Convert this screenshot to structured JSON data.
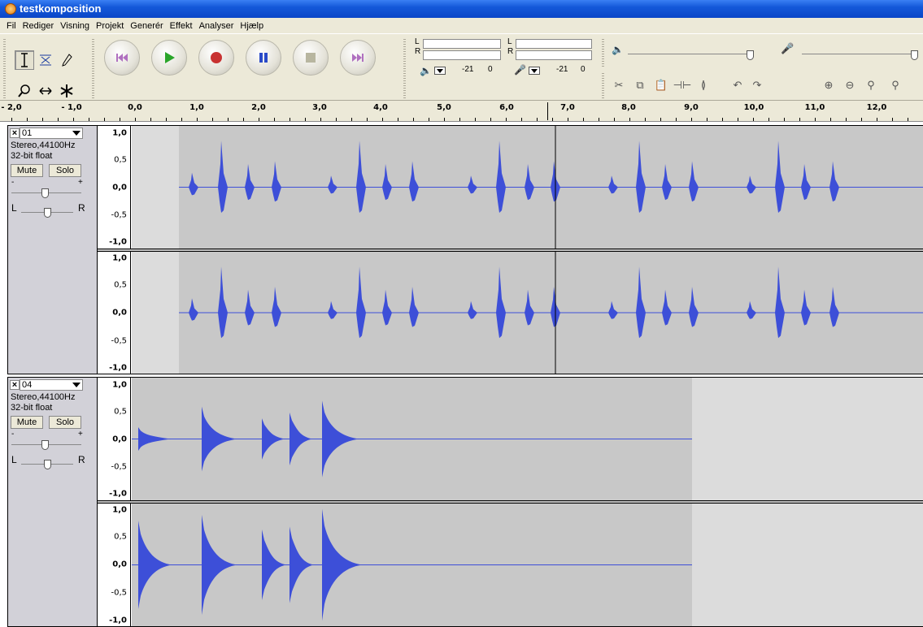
{
  "window": {
    "title": "testkomposition"
  },
  "menu": [
    "Fil",
    "Rediger",
    "Visning",
    "Projekt",
    "Generér",
    "Effekt",
    "Analyser",
    "Hjælp"
  ],
  "tools": [
    {
      "name": "selection-tool",
      "glyph": "I"
    },
    {
      "name": "envelope-tool",
      "glyph": "⋞"
    },
    {
      "name": "draw-tool",
      "glyph": "✎"
    },
    {
      "name": "zoom-tool",
      "glyph": "⚲"
    },
    {
      "name": "timeshift-tool",
      "glyph": "↔"
    },
    {
      "name": "multi-tool",
      "glyph": "✱"
    }
  ],
  "meters": {
    "playback": {
      "left": "L",
      "right": "R",
      "db": "-21",
      "zero": "0"
    },
    "record": {
      "left": "L",
      "right": "R",
      "db": "-21",
      "zero": "0"
    }
  },
  "ruler": {
    "labels": [
      "- 2,0",
      "- 1,0",
      "0,0",
      "1,0",
      "2,0",
      "3,0",
      "4,0",
      "5,0",
      "6,0",
      "7,0",
      "8,0",
      "9,0",
      "10,0",
      "11,0",
      "12,0"
    ]
  },
  "tracks": [
    {
      "name": "01",
      "format": "Stereo,44100Hz",
      "bits": "32-bit float",
      "mute": "Mute",
      "solo": "Solo",
      "gain_minus": "-",
      "gain_plus": "+",
      "pan_left": "L",
      "pan_right": "R",
      "scale": [
        "1,0",
        "0,5",
        "0,0",
        "-0,5",
        "-1,0"
      ]
    },
    {
      "name": "04",
      "format": "Stereo,44100Hz",
      "bits": "32-bit float",
      "mute": "Mute",
      "solo": "Solo",
      "gain_minus": "-",
      "gain_plus": "+",
      "pan_left": "L",
      "pan_right": "R",
      "scale": [
        "1,0",
        "0,5",
        "0,0",
        "-0,5",
        "-1,0"
      ]
    }
  ],
  "colors": {
    "waveform": "#3d4fd8",
    "track_bg": "#c8c8c8",
    "empty_bg": "#dcdcdc",
    "panel": "#d2d1d8"
  }
}
